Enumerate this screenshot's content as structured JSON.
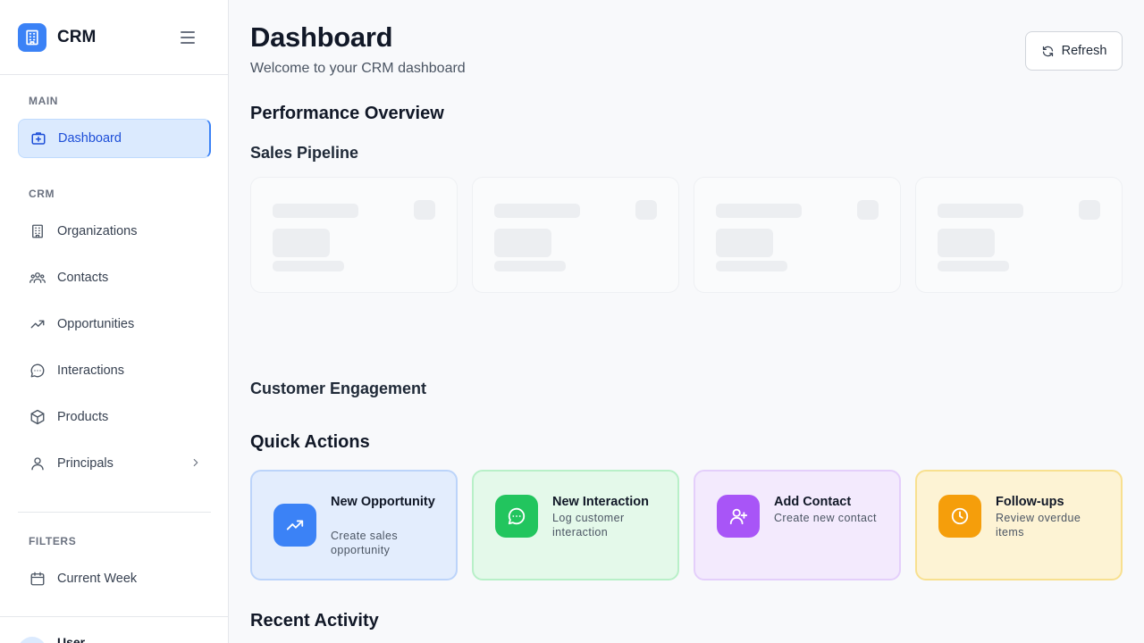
{
  "brand": {
    "name": "CRM"
  },
  "sidebar": {
    "sections": [
      "MAIN",
      "CRM",
      "FILTERS"
    ],
    "items": [
      {
        "label": "Dashboard",
        "icon": "dashboard-icon"
      },
      {
        "label": "Organizations",
        "icon": "building-icon"
      },
      {
        "label": "Contacts",
        "icon": "users-icon"
      },
      {
        "label": "Opportunities",
        "icon": "trending-up-icon"
      },
      {
        "label": "Interactions",
        "icon": "message-icon"
      },
      {
        "label": "Products",
        "icon": "box-icon"
      },
      {
        "label": "Principals",
        "icon": "user-icon"
      },
      {
        "label": "Current Week",
        "icon": "calendar-icon"
      }
    ],
    "user": {
      "name": "User"
    }
  },
  "header": {
    "title": "Dashboard",
    "subtitle": "Welcome to your CRM dashboard",
    "refresh_label": "Refresh"
  },
  "sections": {
    "performance": "Performance Overview",
    "pipeline": "Sales Pipeline",
    "engagement": "Customer Engagement",
    "quick_actions": "Quick Actions",
    "recent_activity": "Recent Activity"
  },
  "quick_actions": [
    {
      "title": "New Opportunity",
      "desc": "Create sales opportunity",
      "icon": "trending-up-icon",
      "color": "#3b82f6"
    },
    {
      "title": "New Interaction",
      "desc": "Log customer interaction",
      "icon": "message-icon",
      "color": "#22c55e"
    },
    {
      "title": "Add Contact",
      "desc": "Create new contact",
      "icon": "user-plus-icon",
      "color": "#a855f7"
    },
    {
      "title": "Follow-ups",
      "desc": "Review overdue items",
      "icon": "clock-icon",
      "color": "#f59e0b"
    }
  ],
  "colors": {
    "accent": "#3b82f6",
    "active_bg": "#dbeafe"
  }
}
